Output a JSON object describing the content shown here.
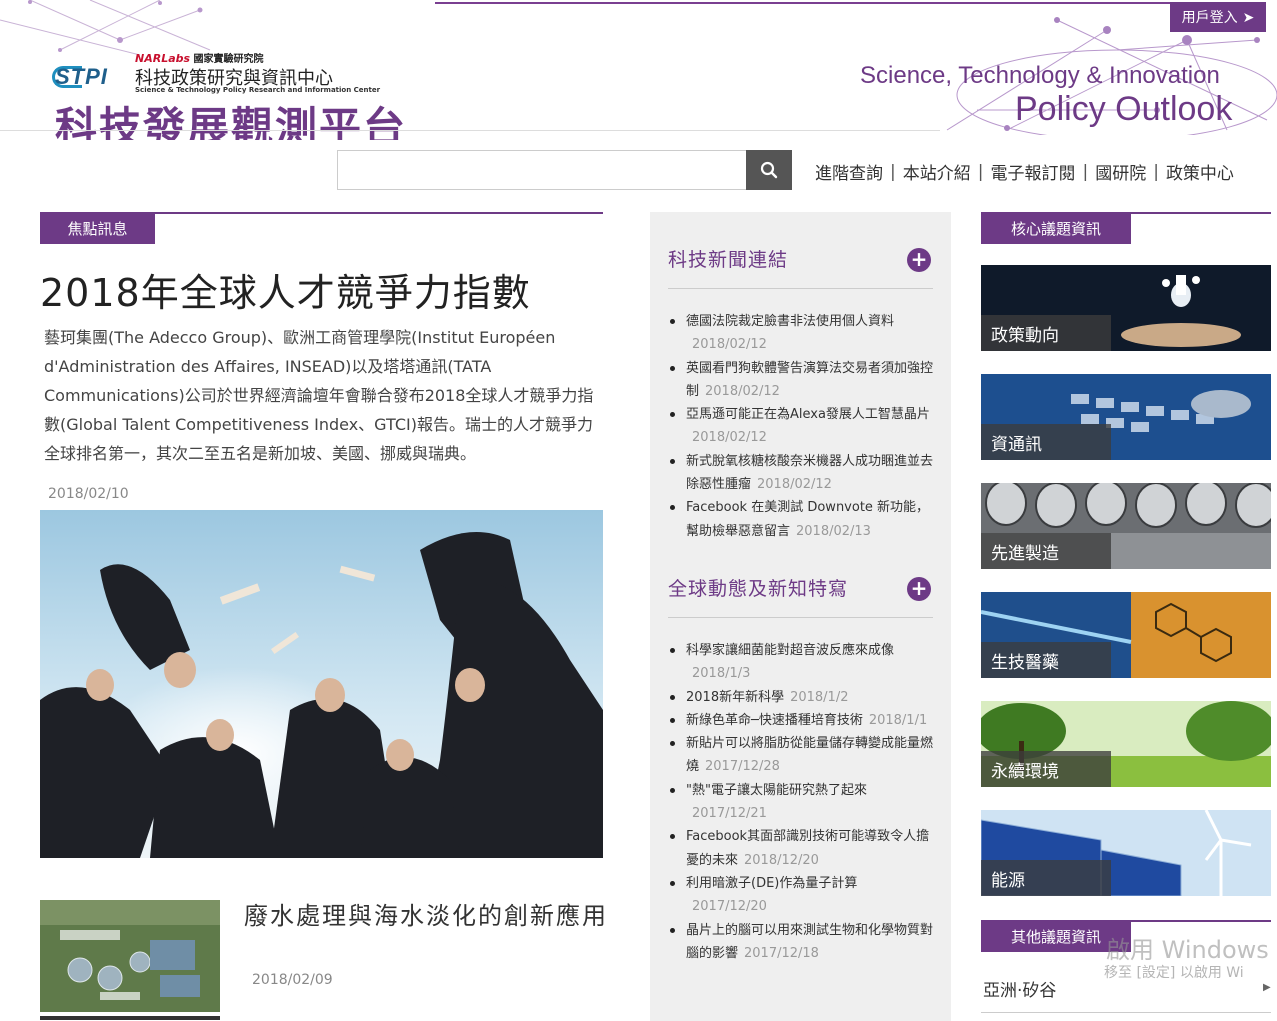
{
  "header": {
    "login_label": "用戶登入",
    "lab_name_red": "NARLabs",
    "lab_name": "國家實驗研究院",
    "org_logo": "STPI",
    "org_name_cn": "科技政策研究與資訊中心",
    "org_name_en": "Science & Technology Policy Research and Information Center",
    "site_title": "科技發展觀測平台",
    "tagline_line1": "Science, Technology & Innovation",
    "tagline_line2": "Policy Outlook",
    "accent_color": "#6d3a86"
  },
  "search": {
    "placeholder": "",
    "button_icon": "search-icon"
  },
  "nav": {
    "items": [
      "進階查詢",
      "本站介紹",
      "電子報訂閱",
      "國研院",
      "政策中心"
    ]
  },
  "focus": {
    "section_label": "焦點訊息",
    "main_title": "2018年全球人才競爭力指數",
    "main_summary": "藝珂集團(The Adecco Group)、歐洲工商管理學院(Institut Européen d'Administration des Affaires, INSEAD)以及塔塔通訊(TATA Communications)公司於世界經濟論壇年會聯合發布2018全球人才競爭力指數(Global Talent Competitiveness Index、GTCI)報告。瑞士的人才競爭力全球排名第一，其次二至五名是新加坡、美國、挪威與瑞典。",
    "main_date": "2018/02/10",
    "second_title": "廢水處理與海水淡化的創新應用",
    "second_date": "2018/02/09"
  },
  "tech_news": {
    "title": "科技新聞連結",
    "items": [
      {
        "text": "德國法院裁定臉書非法使用個人資料",
        "date": "2018/02/12"
      },
      {
        "text": "英國看門狗軟體警告演算法交易者須加強控制",
        "date": "2018/02/12"
      },
      {
        "text": "亞馬遜可能正在為Alexa發展人工智慧晶片",
        "date": "2018/02/12"
      },
      {
        "text": "新式脫氧核糖核酸奈米機器人成功睏進並去除惡性腫瘤",
        "date": "2018/02/12"
      },
      {
        "text": "Facebook 在美測試 Downvote 新功能，幫助檢舉惡意留言",
        "date": "2018/02/13"
      }
    ]
  },
  "global_news": {
    "title": "全球動態及新知特寫",
    "items": [
      {
        "text": "科學家讓細菌能對超音波反應來成像",
        "date": "2018/1/3"
      },
      {
        "text": "2018新年新科學",
        "date": "2018/1/2"
      },
      {
        "text": "新綠色革命─快速播種培育技術",
        "date": "2018/1/1"
      },
      {
        "text": "新貼片可以將脂肪從能量儲存轉變成能量燃燒",
        "date": "2017/12/28"
      },
      {
        "text": "\"熱\"電子讓太陽能研究熱了起來",
        "date": "2017/12/21"
      },
      {
        "text": "Facebook其面部識別技術可能導致令人擔憂的未來",
        "date": "2018/12/20"
      },
      {
        "text": "利用暗激子(DE)作為量子計算",
        "date": "2017/12/20"
      },
      {
        "text": "晶片上的腦可以用來測試生物和化學物質對腦的影響",
        "date": "2017/12/18"
      }
    ]
  },
  "core": {
    "section_label": "核心議題資訊",
    "tiles": [
      "政策動向",
      "資通訊",
      "先進製造",
      "生技醫藥",
      "永續環境",
      "能源"
    ]
  },
  "other": {
    "section_label": "其他議題資訊",
    "items": [
      "亞洲·矽谷"
    ]
  },
  "watermark": {
    "line1": "啟用 Windows",
    "line2": "移至 [設定] 以啟用 Wi"
  }
}
